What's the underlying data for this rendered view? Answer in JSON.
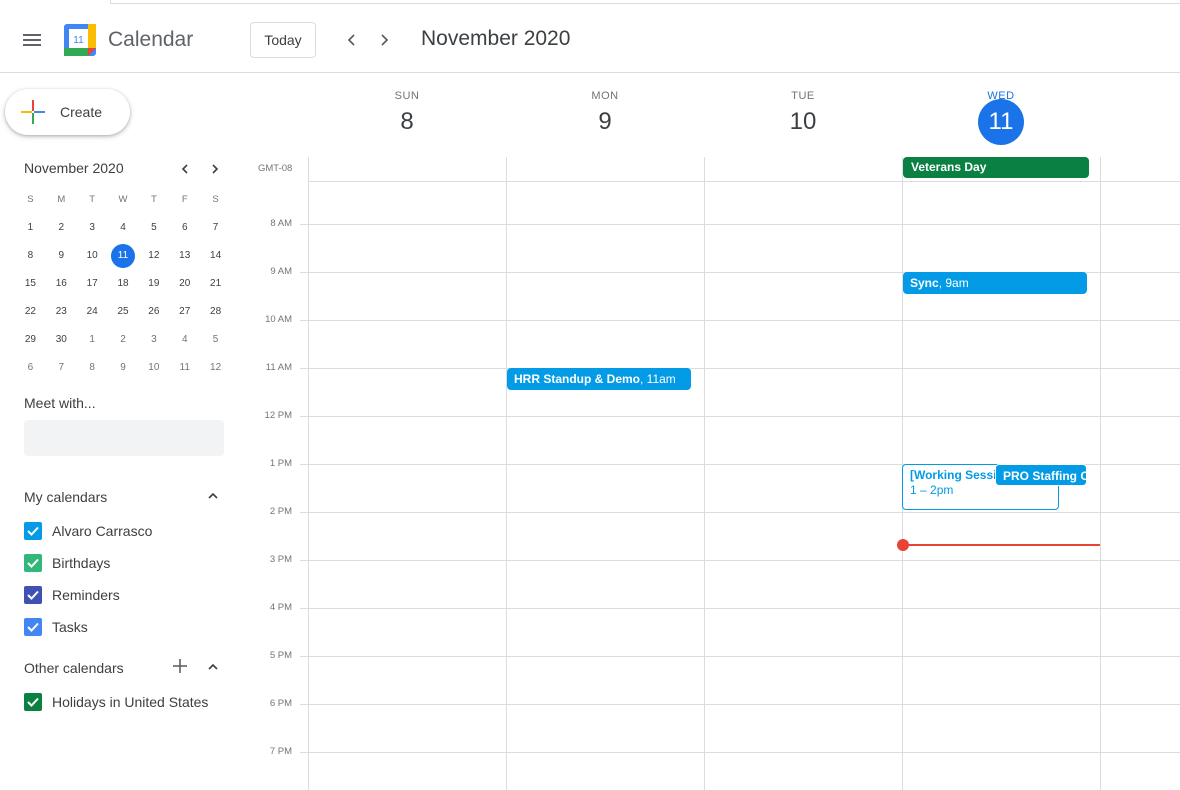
{
  "header": {
    "app_title": "Calendar",
    "logo_day": "11",
    "today_label": "Today",
    "period": "November 2020"
  },
  "sidebar": {
    "create_label": "Create",
    "mini": {
      "title": "November 2020",
      "weekday_heads": [
        "S",
        "M",
        "T",
        "W",
        "T",
        "F",
        "S"
      ],
      "weeks": [
        [
          "1",
          "2",
          "3",
          "4",
          "5",
          "6",
          "7"
        ],
        [
          "8",
          "9",
          "10",
          "11",
          "12",
          "13",
          "14"
        ],
        [
          "15",
          "16",
          "17",
          "18",
          "19",
          "20",
          "21"
        ],
        [
          "22",
          "23",
          "24",
          "25",
          "26",
          "27",
          "28"
        ],
        [
          "29",
          "30",
          "1",
          "2",
          "3",
          "4",
          "5"
        ],
        [
          "6",
          "7",
          "8",
          "9",
          "10",
          "11",
          "12"
        ]
      ],
      "today": "11"
    },
    "meet_with_label": "Meet with...",
    "my_calendars_label": "My calendars",
    "my_calendars": [
      {
        "name": "Alvaro Carrasco",
        "color": "#039be5"
      },
      {
        "name": "Birthdays",
        "color": "#33b679"
      },
      {
        "name": "Reminders",
        "color": "#3f51b5"
      },
      {
        "name": "Tasks",
        "color": "#4285f4"
      }
    ],
    "other_calendars_label": "Other calendars",
    "other_calendars": [
      {
        "name": "Holidays in United States",
        "color": "#0b8043"
      }
    ]
  },
  "week": {
    "timezone": "GMT-08",
    "days": [
      {
        "dow": "SUN",
        "num": "8"
      },
      {
        "dow": "MON",
        "num": "9"
      },
      {
        "dow": "TUE",
        "num": "10"
      },
      {
        "dow": "WED",
        "num": "11",
        "today": true
      }
    ],
    "hours": [
      "8 AM",
      "9 AM",
      "10 AM",
      "11 AM",
      "12 PM",
      "1 PM",
      "2 PM",
      "3 PM",
      "4 PM",
      "5 PM",
      "6 PM",
      "7 PM"
    ]
  },
  "events": {
    "veterans": {
      "title": "Veterans Day",
      "color": "#0b8043"
    },
    "sync": {
      "title": "Sync",
      "time": ", 9am",
      "color": "#039be5"
    },
    "hrr": {
      "title": "HRR Standup & Demo",
      "time": ", 11am",
      "color": "#039be5"
    },
    "working": {
      "title": "[Working Session",
      "time": "1 – 2pm"
    },
    "pro": {
      "title": "PRO Staffing Or",
      "color": "#039be5"
    }
  }
}
